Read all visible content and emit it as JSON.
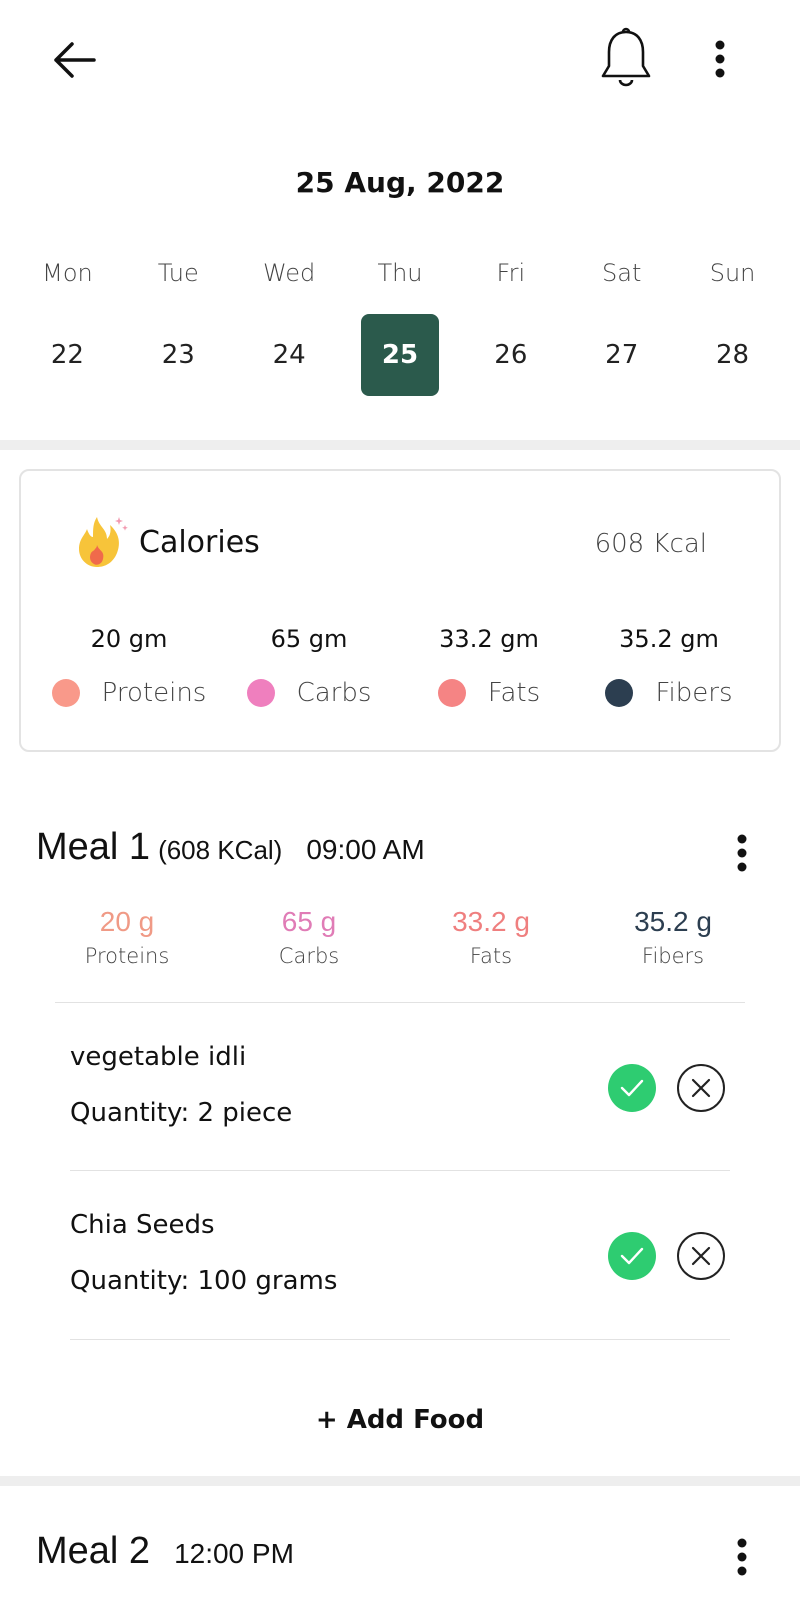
{
  "header": {
    "back_icon": "arrow-left-icon",
    "bell_icon": "bell-icon",
    "menu_icon": "more-vertical-icon"
  },
  "date_title": "25 Aug, 2022",
  "week": {
    "days": [
      {
        "name": "Mon",
        "num": "22"
      },
      {
        "name": "Tue",
        "num": "23"
      },
      {
        "name": "Wed",
        "num": "24"
      },
      {
        "name": "Thu",
        "num": "25"
      },
      {
        "name": "Fri",
        "num": "26"
      },
      {
        "name": "Sat",
        "num": "27"
      },
      {
        "name": "Sun",
        "num": "28"
      }
    ],
    "selected_index": 3,
    "selected_color": "#2b5a4c"
  },
  "calories": {
    "title": "Calories",
    "total": "608 Kcal",
    "macros": [
      {
        "value": "20 gm",
        "name": "Proteins",
        "color": "#f9998a"
      },
      {
        "value": "65 gm",
        "name": "Carbs",
        "color": "#ef7fbe"
      },
      {
        "value": "33.2 gm",
        "name": "Fats",
        "color": "#f58484"
      },
      {
        "value": "35.2 gm",
        "name": "Fibers",
        "color": "#2c3e50"
      }
    ]
  },
  "meals": [
    {
      "name": "Meal 1",
      "kcal": "(608 KCal)",
      "time": "09:00 AM",
      "macros": [
        {
          "value": "20 g",
          "label": "Proteins",
          "color": "#f09a86"
        },
        {
          "value": "65 g",
          "label": "Carbs",
          "color": "#e07cb6"
        },
        {
          "value": "33.2 g",
          "label": "Fats",
          "color": "#ef7f7f"
        },
        {
          "value": "35.2 g",
          "label": "Fibers",
          "color": "#2c3e50"
        }
      ],
      "foods": [
        {
          "name": "vegetable idli",
          "quantity": "Quantity: 2 piece"
        },
        {
          "name": "Chia Seeds",
          "quantity": "Quantity: 100 grams"
        }
      ],
      "add_food_label": "+ Add Food"
    },
    {
      "name": "Meal 2",
      "kcal": "",
      "time": "12:00 PM"
    }
  ],
  "colors": {
    "check_green": "#2ecc71",
    "divider": "#eeeeee"
  }
}
